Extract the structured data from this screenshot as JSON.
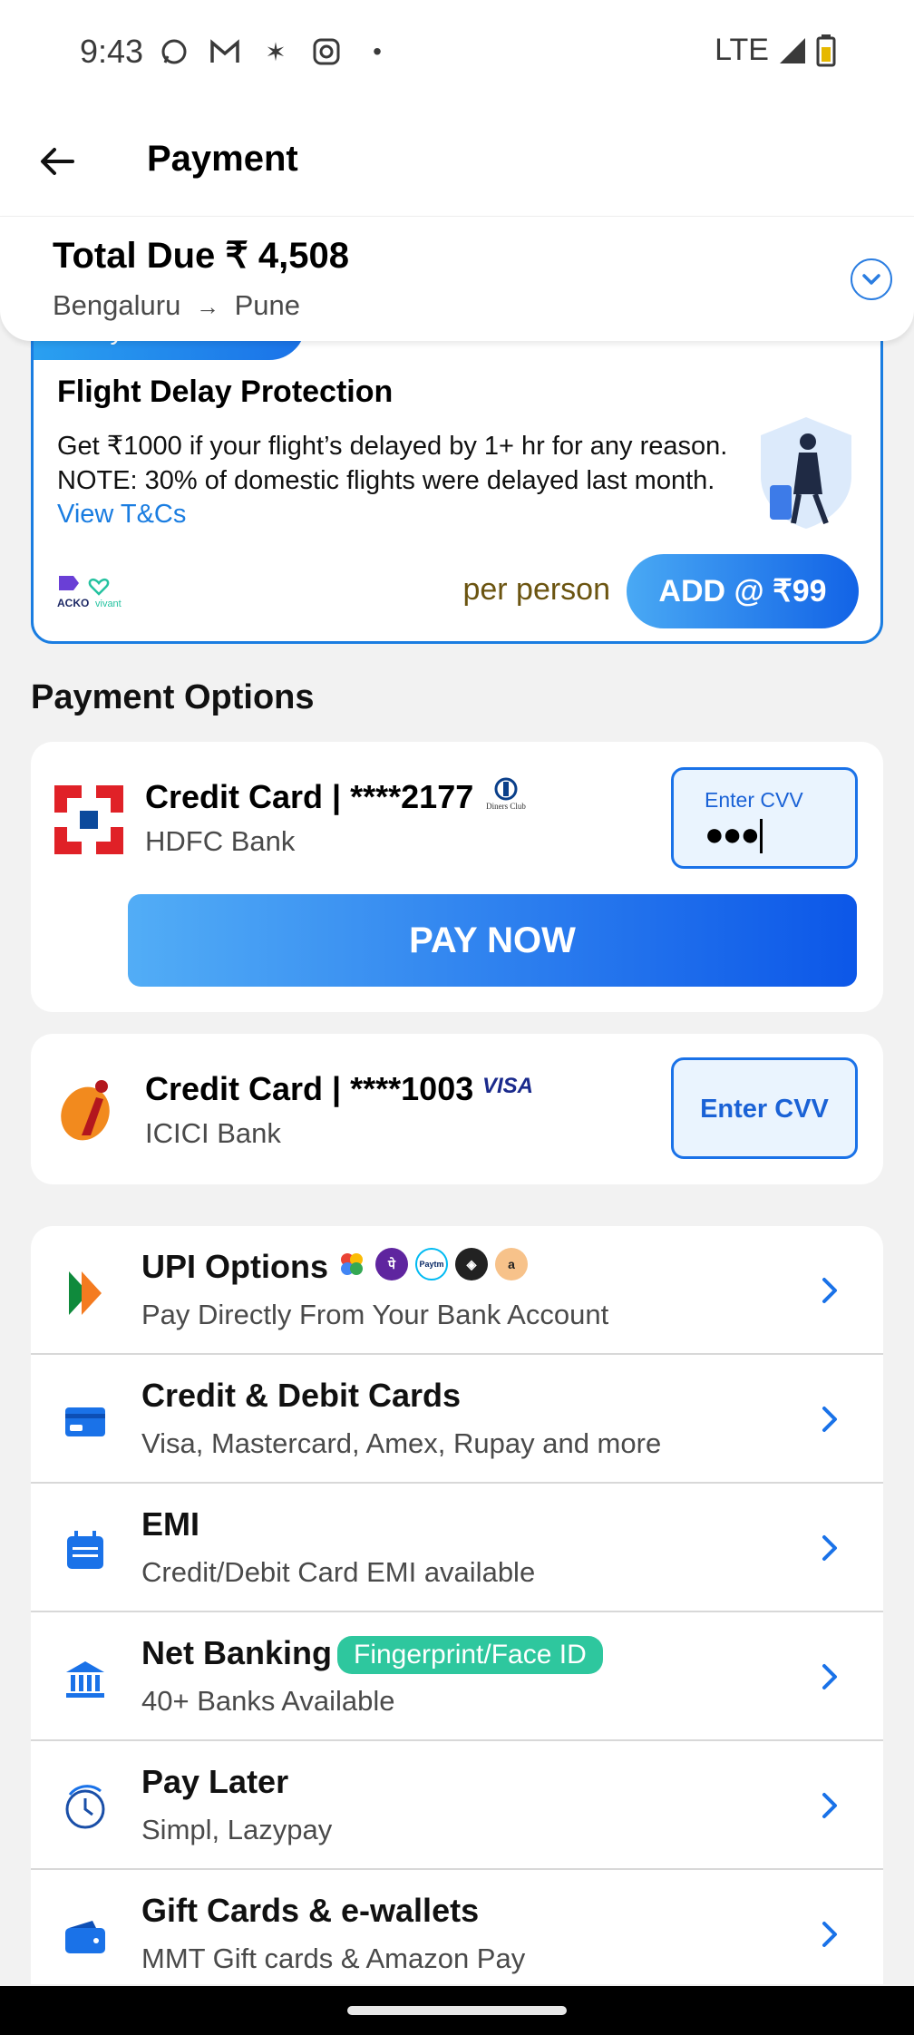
{
  "status": {
    "time": "9:43",
    "network": "LTE"
  },
  "header": {
    "title": "Payment"
  },
  "summary": {
    "total_label": "Total Due ₹ 4,508",
    "from": "Bengaluru",
    "arrow": "→",
    "to": "Pune"
  },
  "insurance": {
    "ribbon": "Worry Free Travel!",
    "title": "Flight Delay Protection",
    "line1": "Get ₹1000 if your flight’s delayed by 1+ hr for any reason.",
    "line2": "NOTE: 30% of domestic flights were delayed last month.",
    "link": "View T&Cs",
    "partner1": "ACKO",
    "partner2": "vivant",
    "per_person": "per person",
    "add_button": "ADD @ ₹99"
  },
  "payment_options_title": "Payment Options",
  "saved_cards": [
    {
      "name": "Credit Card | ****2177",
      "bank": "HDFC Bank",
      "network": "Diners Club",
      "cvv_label": "Enter CVV",
      "cvv_value": "●●●",
      "pay_button": "PAY NOW"
    },
    {
      "name": "Credit Card | ****1003",
      "bank": "ICICI Bank",
      "network": "VISA",
      "cvv_label": "Enter CVV"
    }
  ],
  "options": [
    {
      "title": "UPI Options",
      "subtitle": "Pay Directly From Your Bank Account",
      "icon": "upi-icon"
    },
    {
      "title": "Credit & Debit Cards",
      "subtitle": "Visa, Mastercard, Amex, Rupay and more",
      "icon": "card-icon"
    },
    {
      "title": "EMI",
      "subtitle": "Credit/Debit Card EMI available",
      "icon": "calendar-icon"
    },
    {
      "title": "Net Banking",
      "subtitle": "40+ Banks Available",
      "badge": "Fingerprint/Face ID",
      "icon": "bank-icon"
    },
    {
      "title": "Pay Later",
      "subtitle": "Simpl, Lazypay",
      "icon": "clock-icon"
    },
    {
      "title": "Gift Cards & e-wallets",
      "subtitle": "MMT Gift cards & Amazon Pay",
      "icon": "wallet-icon"
    }
  ],
  "colors": {
    "accent": "#1a72e8",
    "badge": "#2ec79e"
  }
}
